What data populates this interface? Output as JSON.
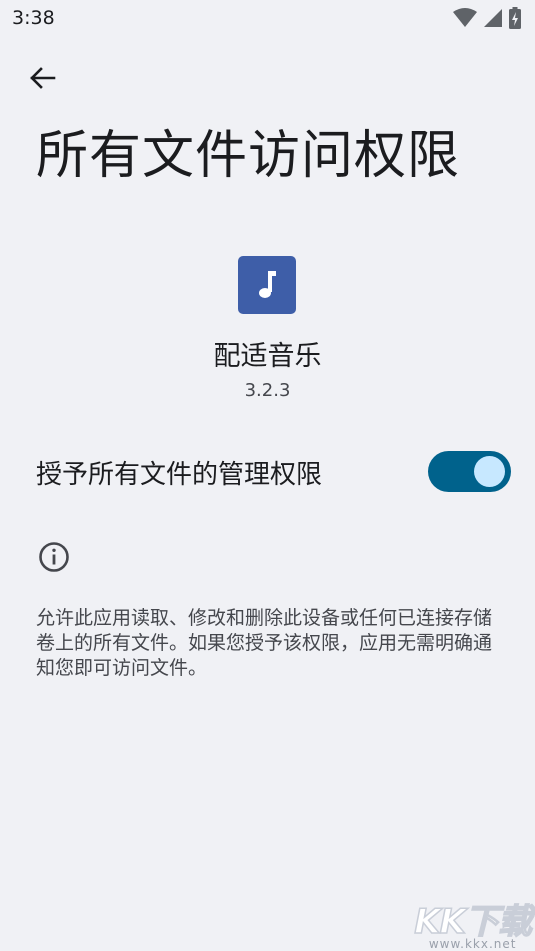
{
  "status_bar": {
    "time": "3:38"
  },
  "header": {
    "title": "所有文件访问权限"
  },
  "app": {
    "name": "配适音乐",
    "version": "3.2.3",
    "icon": "music-note-icon",
    "icon_bg": "#3e5ea8"
  },
  "permission": {
    "label": "授予所有文件的管理权限",
    "enabled": true,
    "switch_color": "#00628c"
  },
  "info": {
    "icon": "info-icon",
    "description": "允许此应用读取、修改和删除此设备或任何已连接存储卷上的所有文件。如果您授予该权限，应用无需明确通知您即可访问文件。"
  },
  "watermark": {
    "logo": "KK下载",
    "url": "www.kkx.net"
  }
}
